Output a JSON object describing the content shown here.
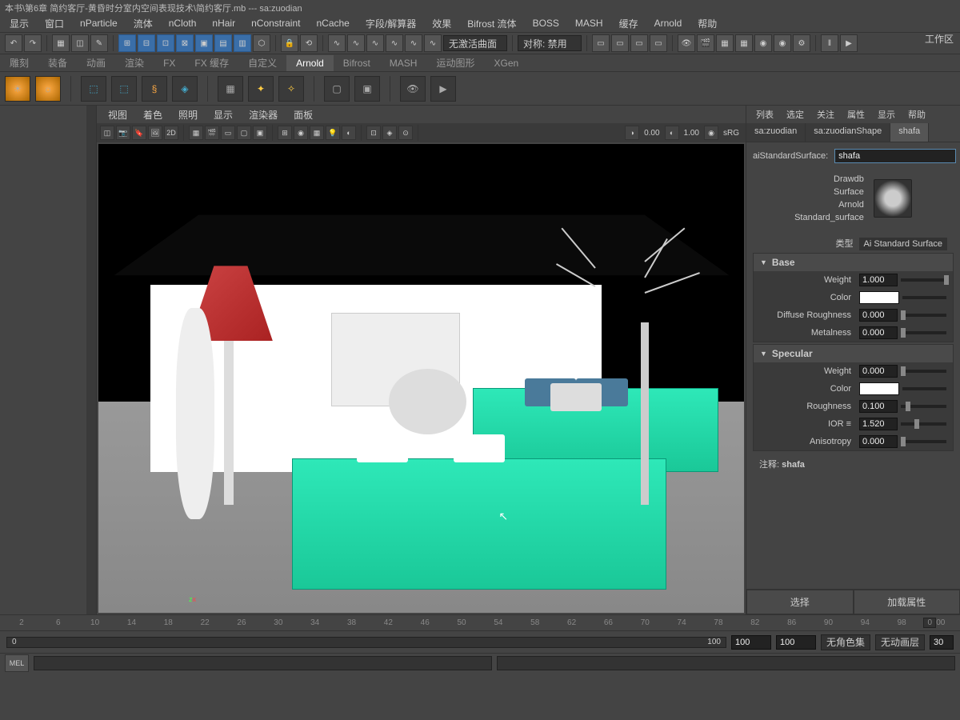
{
  "title": "本书\\第6章 简约客厅-黄昏时分室内空间表现技术\\简约客厅.mb  ---  sa:zuodian",
  "workspace_label": "工作区",
  "menubar": [
    "显示",
    "窗口",
    "nParticle",
    "流体",
    "nCloth",
    "nHair",
    "nConstraint",
    "nCache",
    "字段/解算器",
    "效果",
    "Bifrost 流体",
    "BOSS",
    "MASH",
    "缓存",
    "Arnold",
    "帮助"
  ],
  "toolbar1": {
    "dropdown1": "无激活曲面",
    "dropdown2": "对称: 禁用"
  },
  "shelf_tabs": [
    "雕刻",
    "装备",
    "动画",
    "渲染",
    "FX",
    "FX 缓存",
    "自定义",
    "Arnold",
    "Bifrost",
    "MASH",
    "运动图形",
    "XGen"
  ],
  "shelf_active": "Arnold",
  "viewport_menu": [
    "视图",
    "着色",
    "照明",
    "显示",
    "渲染器",
    "面板"
  ],
  "viewport_toolbar": {
    "val1": "0.00",
    "val2": "1.00",
    "srgb": "sRG"
  },
  "attribute_editor": {
    "menu": [
      "列表",
      "选定",
      "关注",
      "属性",
      "显示",
      "帮助"
    ],
    "tabs": [
      "sa:zuodian",
      "sa:zuodianShape",
      "shafa"
    ],
    "active_tab": "shafa",
    "field_label": "aiStandardSurface:",
    "field_value": "shafa",
    "preview_lines": [
      "Drawdb",
      "Surface",
      "Arnold",
      "Standard_surface"
    ],
    "type_label": "类型",
    "type_value": "Ai Standard Surface",
    "sections": {
      "base": {
        "title": "Base",
        "attrs": [
          {
            "label": "Weight",
            "value": "1.000",
            "slider": 100
          },
          {
            "label": "Color",
            "swatch": "#ffffff"
          },
          {
            "label": "Diffuse Roughness",
            "value": "0.000",
            "slider": 0
          },
          {
            "label": "Metalness",
            "value": "0.000",
            "slider": 0
          }
        ]
      },
      "specular": {
        "title": "Specular",
        "attrs": [
          {
            "label": "Weight",
            "value": "0.000",
            "slider": 0
          },
          {
            "label": "Color",
            "swatch": "#ffffff"
          },
          {
            "label": "Roughness",
            "value": "0.100",
            "slider": 10
          },
          {
            "label": "IOR ≡",
            "value": "1.520",
            "slider": 30
          },
          {
            "label": "Anisotropy",
            "value": "0.000",
            "slider": 0
          }
        ]
      }
    },
    "note_label": "注释:",
    "note_value": "shafa",
    "btn_select": "选择",
    "btn_load": "加载属性"
  },
  "timeline": {
    "ticks": [
      "2",
      "6",
      "10",
      "14",
      "18",
      "22",
      "26",
      "30",
      "34",
      "38",
      "42",
      "46",
      "50",
      "54",
      "58",
      "62",
      "66",
      "70",
      "74",
      "78",
      "82",
      "86",
      "90",
      "94",
      "98",
      "100"
    ],
    "current": "0"
  },
  "range": {
    "start": "0",
    "end": "100",
    "r1": "100",
    "r2": "100",
    "charset": "无角色集",
    "layer": "无动画层",
    "fps": "30"
  }
}
